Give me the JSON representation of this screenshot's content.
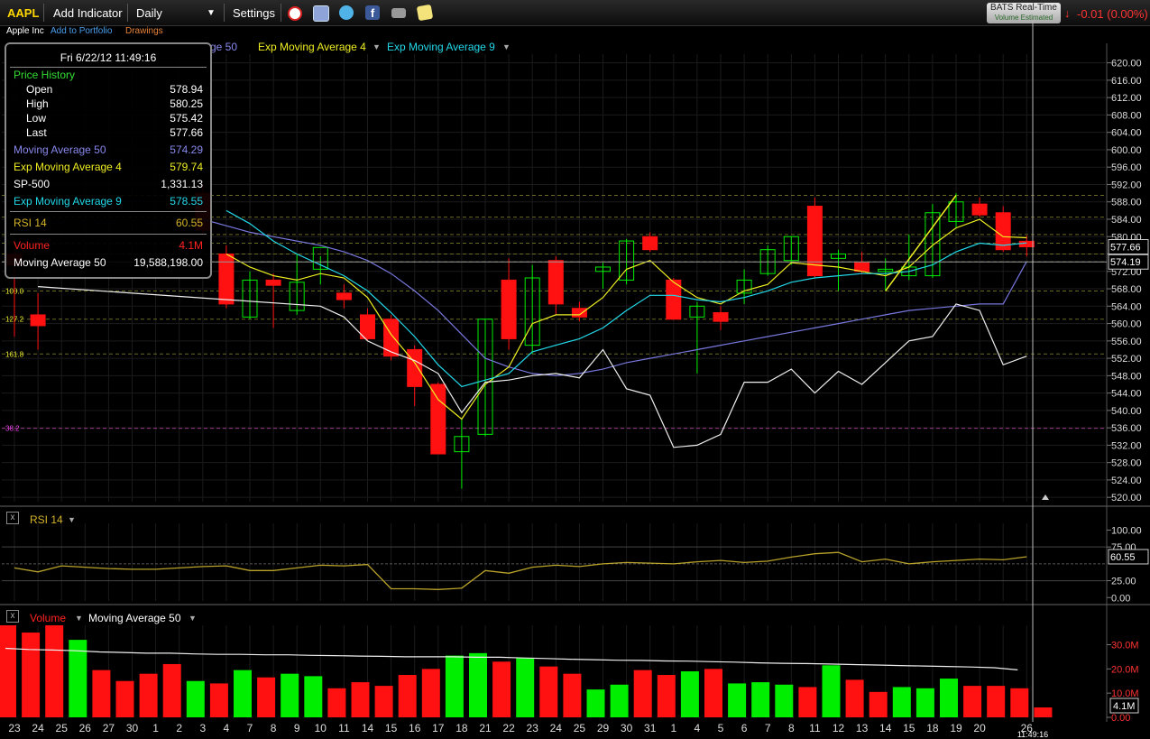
{
  "toolbar": {
    "symbol": "AAPL",
    "add_indicator": "Add Indicator",
    "period": "Daily",
    "settings": "Settings",
    "icons": [
      "alarm-clock-icon",
      "copy-icon",
      "twitter-icon",
      "facebook-icon",
      "camera-icon",
      "note-icon"
    ]
  },
  "subbar": {
    "company": "Apple Inc",
    "add_portfolio": "Add to Portfolio",
    "drawings": "Drawings"
  },
  "realtime": {
    "label": "BATS Real-Time",
    "sub": "Volume Estimated",
    "change": "-0.01 (0.00%)"
  },
  "legend": {
    "ma50_partial": "ge 50",
    "ema4": "Exp Moving Average 4",
    "ema9": "Exp Moving Average 9"
  },
  "colors": {
    "up": "#00ee00",
    "down": "#ff1111",
    "ma50": "#7777dd",
    "ema4": "#eeee22",
    "ema9": "#22d8e8",
    "sp500": "#eeeeee",
    "rsi": "#b8a22a",
    "volma": "#eeeeee"
  },
  "tooltip": {
    "date": "Fri 6/22/12 11:49:16",
    "header": "Price History",
    "open_k": "Open",
    "open_v": "578.94",
    "high_k": "High",
    "high_v": "580.25",
    "low_k": "Low",
    "low_v": "575.42",
    "last_k": "Last",
    "last_v": "577.66",
    "ma50_k": "Moving Average 50",
    "ma50_v": "574.29",
    "ema4_k": "Exp Moving Average 4",
    "ema4_v": "579.74",
    "sp_k": "SP-500",
    "sp_v": "1,331.13",
    "ema9_k": "Exp Moving Average 9",
    "ema9_v": "578.55",
    "rsi_k": "RSI 14",
    "rsi_v": "60.55",
    "vol_k": "Volume",
    "vol_v": "4.1M",
    "volma_k": "Moving Average 50",
    "volma_v": "19,588,198.00"
  },
  "rsi_panel": {
    "title": "RSI 14",
    "value_box": "60.55"
  },
  "volume_panel": {
    "title": "Volume",
    "ma_title": "Moving Average 50",
    "value_box": "4.1M"
  },
  "price_boxes": {
    "last": "577.66",
    "ma50": "574.19"
  },
  "fib_labels": [
    {
      "text": "100.0",
      "price": 567.5
    },
    {
      "text": "127.2",
      "price": 561.0
    },
    {
      "text": "161.8",
      "price": 553.0
    },
    {
      "text": "38.2",
      "price": 535.9
    }
  ],
  "crosshair_time": "11:49:16",
  "chart_data": [
    {
      "type": "candlestick",
      "y_axis_ticks": [
        "620.00",
        "616.00",
        "612.00",
        "608.00",
        "604.00",
        "600.00",
        "596.00",
        "592.00",
        "588.00",
        "584.00",
        "580.00",
        "576.00",
        "572.00",
        "568.00",
        "564.00",
        "560.00",
        "556.00",
        "552.00",
        "548.00",
        "544.00",
        "540.00",
        "536.00",
        "532.00",
        "528.00",
        "524.00",
        "520.00"
      ],
      "ylim": [
        519,
        622
      ],
      "x_tick_labels": [
        "23",
        "24",
        "25",
        "26",
        "27",
        "30",
        "1",
        "2",
        "3",
        "4",
        "7",
        "8",
        "9",
        "10",
        "11",
        "14",
        "15",
        "16",
        "17",
        "18",
        "21",
        "22",
        "23",
        "24",
        "25",
        "29",
        "30",
        "31",
        "1",
        "4",
        "5",
        "6",
        "7",
        "8",
        "11",
        "12",
        "13",
        "14",
        "15",
        "18",
        "19",
        "20",
        "",
        "26"
      ],
      "candles": [
        {
          "o": 576.0,
          "h": 578.5,
          "l": 557.0,
          "c": 573.5
        },
        {
          "o": 562.0,
          "h": 567.0,
          "l": 554.0,
          "c": 559.5
        },
        {
          "o": 0,
          "h": 0,
          "l": 0,
          "c": 0
        },
        {
          "o": 0,
          "h": 0,
          "l": 0,
          "c": 0
        },
        {
          "o": 0,
          "h": 0,
          "l": 0,
          "c": 0
        },
        {
          "o": 0,
          "h": 0,
          "l": 0,
          "c": 0
        },
        {
          "o": 0,
          "h": 0,
          "l": 0,
          "c": 0
        },
        {
          "o": 0,
          "h": 0,
          "l": 0,
          "c": 0
        },
        {
          "o": 590.0,
          "h": 592.0,
          "l": 580.5,
          "c": 581.5
        },
        {
          "o": 576.0,
          "h": 578.0,
          "l": 563.5,
          "c": 564.5
        },
        {
          "o": 561.5,
          "h": 572.0,
          "l": 561.0,
          "c": 570.0
        },
        {
          "o": 570.0,
          "h": 571.5,
          "l": 559.0,
          "c": 568.8
        },
        {
          "o": 563.0,
          "h": 576.0,
          "l": 562.0,
          "c": 569.5
        },
        {
          "o": 572.5,
          "h": 575.5,
          "l": 569.0,
          "c": 577.5
        },
        {
          "o": 567.0,
          "h": 569.0,
          "l": 563.5,
          "c": 565.5
        },
        {
          "o": 562.0,
          "h": 563.5,
          "l": 556.0,
          "c": 556.5
        },
        {
          "o": 561.0,
          "h": 562.0,
          "l": 551.5,
          "c": 552.5
        },
        {
          "o": 554.0,
          "h": 555.0,
          "l": 541.0,
          "c": 545.5
        },
        {
          "o": 546.0,
          "h": 546.5,
          "l": 530.0,
          "c": 530.0
        },
        {
          "o": 530.5,
          "h": 538.0,
          "l": 522.0,
          "c": 534.0
        },
        {
          "o": 534.5,
          "h": 561.0,
          "l": 534.0,
          "c": 561.0
        },
        {
          "o": 570.0,
          "h": 575.0,
          "l": 554.0,
          "c": 556.5
        },
        {
          "o": 555.0,
          "h": 573.5,
          "l": 553.0,
          "c": 570.5
        },
        {
          "o": 574.5,
          "h": 575.5,
          "l": 562.0,
          "c": 564.5
        },
        {
          "o": 563.5,
          "h": 565.0,
          "l": 560.5,
          "c": 561.5
        },
        {
          "o": 572.0,
          "h": 574.0,
          "l": 568.0,
          "c": 573.0
        },
        {
          "o": 570.0,
          "h": 579.5,
          "l": 569.0,
          "c": 579.0
        },
        {
          "o": 580.0,
          "h": 581.0,
          "l": 576.5,
          "c": 577.0
        },
        {
          "o": 570.0,
          "h": 570.5,
          "l": 561.0,
          "c": 561.0
        },
        {
          "o": 561.5,
          "h": 565.0,
          "l": 548.5,
          "c": 564.0
        },
        {
          "o": 562.5,
          "h": 564.0,
          "l": 558.5,
          "c": 560.5
        },
        {
          "o": 567.0,
          "h": 572.5,
          "l": 564.5,
          "c": 570.0
        },
        {
          "o": 571.5,
          "h": 578.0,
          "l": 571.0,
          "c": 577.0
        },
        {
          "o": 574.5,
          "h": 580.0,
          "l": 573.5,
          "c": 580.0
        },
        {
          "o": 587.0,
          "h": 589.0,
          "l": 570.5,
          "c": 571.0
        },
        {
          "o": 575.0,
          "h": 577.0,
          "l": 567.5,
          "c": 576.0
        },
        {
          "o": 574.0,
          "h": 576.5,
          "l": 571.5,
          "c": 572.0
        },
        {
          "o": 572.0,
          "h": 575.0,
          "l": 567.5,
          "c": 572.5
        },
        {
          "o": 571.0,
          "h": 580.5,
          "l": 570.0,
          "c": 573.0
        },
        {
          "o": 571.0,
          "h": 587.5,
          "l": 570.5,
          "c": 585.5
        },
        {
          "o": 583.5,
          "h": 590.0,
          "l": 582.0,
          "c": 588.0
        },
        {
          "o": 587.5,
          "h": 589.0,
          "l": 584.5,
          "c": 585.0
        },
        {
          "o": 585.5,
          "h": 587.0,
          "l": 576.5,
          "c": 577.0
        },
        {
          "o": 578.94,
          "h": 580.25,
          "l": 575.42,
          "c": 577.66
        }
      ],
      "series": [
        {
          "name": "Moving Average 50",
          "values": [
            null,
            null,
            null,
            null,
            null,
            null,
            null,
            null,
            584.0,
            582.5,
            581.0,
            580.0,
            579.0,
            578.0,
            576.5,
            574.5,
            571.5,
            567.5,
            563.0,
            557.5,
            552.0,
            550.0,
            548.5,
            548.0,
            548.5,
            549.5,
            551.0,
            552.0,
            553.0,
            554.0,
            555.0,
            556.0,
            557.0,
            558.0,
            559.0,
            560.0,
            561.0,
            562.0,
            563.0,
            563.5,
            564.0,
            564.5,
            564.5,
            574.29
          ]
        },
        {
          "name": "Exp Moving Average 4",
          "values": [
            null,
            null,
            null,
            null,
            null,
            null,
            null,
            null,
            null,
            576.0,
            573.0,
            571.0,
            570.0,
            571.5,
            570.5,
            566.0,
            557.5,
            551.0,
            542.5,
            538.0,
            546.0,
            550.0,
            560.0,
            562.0,
            562.0,
            566.0,
            572.5,
            574.5,
            569.5,
            566.0,
            564.5,
            567.5,
            569.0,
            574.0,
            573.5,
            573.0,
            572.0,
            571.0,
            573.0,
            578.0,
            582.0,
            584.0,
            580.0,
            579.74
          ]
        },
        {
          "name": "Exp Moving Average 9",
          "values": [
            null,
            null,
            null,
            null,
            null,
            null,
            null,
            null,
            null,
            586.0,
            583.0,
            579.0,
            576.0,
            573.5,
            571.0,
            567.5,
            562.5,
            557.0,
            550.5,
            545.5,
            547.0,
            548.5,
            553.5,
            555.0,
            556.5,
            559.0,
            563.0,
            566.5,
            566.5,
            565.5,
            565.0,
            566.0,
            567.5,
            569.5,
            570.5,
            571.0,
            571.5,
            571.5,
            572.0,
            573.5,
            576.5,
            578.5,
            578.0,
            578.55
          ]
        },
        {
          "name": "SP-500",
          "values": [
            null,
            568.5,
            null,
            null,
            null,
            null,
            null,
            null,
            null,
            null,
            null,
            null,
            null,
            564.0,
            561.5,
            556.0,
            553.5,
            551.5,
            548.5,
            539.5,
            546.5,
            547.0,
            548.0,
            548.5,
            547.5,
            554.0,
            545.0,
            543.5,
            531.5,
            532.0,
            534.5,
            546.5,
            546.5,
            549.5,
            544.0,
            549.0,
            546.0,
            551.0,
            556.0,
            557.0,
            564.5,
            563.0,
            550.5,
            552.5
          ]
        },
        {
          "name": "Exp Moving Average 4 (swing)",
          "values": [
            null,
            null,
            null,
            null,
            null,
            null,
            null,
            null,
            null,
            null,
            null,
            null,
            null,
            null,
            null,
            null,
            null,
            null,
            null,
            null,
            null,
            null,
            null,
            null,
            null,
            null,
            null,
            null,
            null,
            null,
            null,
            null,
            null,
            null,
            null,
            null,
            null,
            567.5,
            null,
            null,
            589.5,
            null,
            null,
            null
          ]
        }
      ],
      "horizontal_levels": [
        589.5,
        584.5,
        580.5,
        578.5,
        576.0,
        574.2,
        567.5,
        561.0,
        553.0,
        535.9
      ]
    },
    {
      "type": "line",
      "title": "RSI 14",
      "y_axis_ticks": [
        "100.00",
        "75.00",
        "25.00",
        "0.00"
      ],
      "ylim": [
        -5,
        110
      ],
      "series": [
        {
          "name": "RSI 14",
          "values": [
            44,
            38,
            47,
            45,
            43,
            42,
            42,
            44,
            46,
            47,
            40,
            40,
            44,
            48,
            47,
            49,
            13,
            13,
            12,
            14,
            40,
            36,
            45,
            48,
            46,
            50,
            52,
            51,
            50,
            53,
            55,
            52,
            54,
            60,
            65,
            67,
            53,
            57,
            50,
            53,
            55,
            57,
            56,
            60.55
          ]
        }
      ]
    },
    {
      "type": "bar",
      "title": "Volume",
      "y_axis_ticks": [
        "30.0M",
        "20.0M",
        "10.0M",
        "0.00"
      ],
      "ylim": [
        0,
        38
      ],
      "values": [
        38.0,
        35.0,
        38.0,
        32.0,
        19.5,
        15.0,
        18.0,
        22.0,
        15.0,
        14.0,
        19.5,
        16.5,
        18.0,
        17.0,
        12.0,
        14.5,
        13.0,
        17.5,
        20.0,
        25.5,
        26.5,
        23.0,
        24.5,
        21.0,
        18.0,
        11.5,
        13.5,
        19.5,
        17.5,
        19.0,
        20.0,
        14.0,
        14.5,
        13.5,
        12.5,
        21.5,
        15.5,
        10.5,
        12.5,
        12.0,
        16.0,
        13.0,
        13.0,
        12.0,
        4.1
      ],
      "up": [
        false,
        false,
        false,
        true,
        false,
        false,
        false,
        false,
        true,
        false,
        true,
        false,
        true,
        true,
        false,
        false,
        false,
        false,
        false,
        true,
        true,
        false,
        true,
        false,
        false,
        true,
        true,
        false,
        false,
        true,
        false,
        true,
        true,
        true,
        false,
        true,
        false,
        false,
        true,
        true,
        true,
        false,
        false,
        false,
        false
      ],
      "series": [
        {
          "name": "Moving Average 50",
          "values": [
            28.5,
            28.0,
            27.8,
            27.5,
            27.0,
            26.8,
            26.5,
            26.5,
            26.2,
            26.0,
            26.0,
            25.8,
            25.8,
            25.6,
            25.5,
            25.3,
            25.2,
            25.0,
            25.0,
            25.0,
            24.8,
            24.8,
            24.5,
            24.3,
            24.0,
            23.8,
            23.6,
            23.5,
            23.3,
            23.2,
            23.0,
            22.8,
            22.5,
            22.3,
            22.2,
            22.0,
            21.8,
            21.6,
            21.4,
            21.2,
            21.0,
            20.8,
            20.5,
            19.6
          ]
        }
      ]
    }
  ]
}
